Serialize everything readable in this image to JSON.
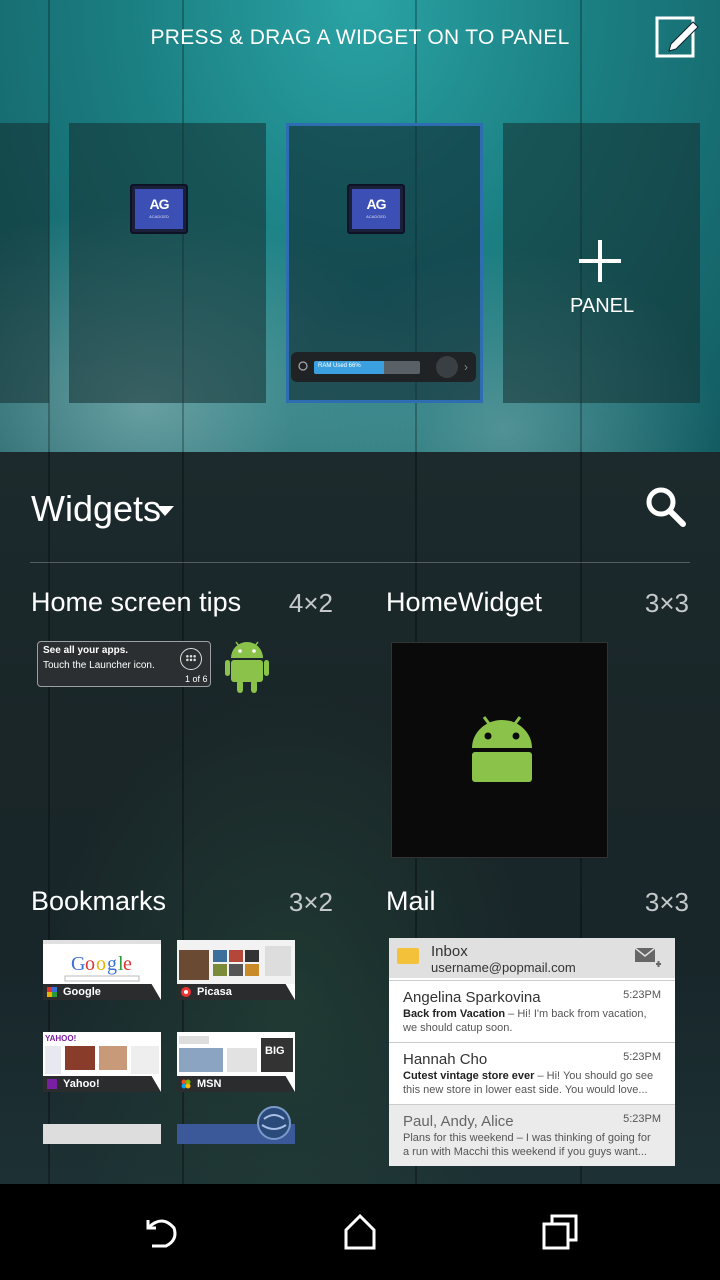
{
  "header": {
    "hint": "PRESS & DRAG A WIDGET ON TO PANEL"
  },
  "panels": {
    "ag_logo_text": "AG",
    "ag_logo_sub": "ACADGED",
    "ram_label": "RAM Used 66%",
    "ram_used_fraction": 0.66,
    "add_panel_label": "PANEL"
  },
  "drawer": {
    "title": "Widgets",
    "widgets": [
      {
        "name": "Home screen tips",
        "size": "4×2"
      },
      {
        "name": "HomeWidget",
        "size": "3×3"
      },
      {
        "name": "Bookmarks",
        "size": "3×2"
      },
      {
        "name": "Mail",
        "size": "3×3"
      }
    ]
  },
  "tips": {
    "line1": "See all your apps.",
    "line2": "Touch the Launcher icon.",
    "counter": "1 of 6"
  },
  "bookmarks": [
    {
      "label": "Google"
    },
    {
      "label": "Picasa"
    },
    {
      "label": "Yahoo!"
    },
    {
      "label": "MSN"
    }
  ],
  "mail": {
    "header_title": "Inbox",
    "account": "username@popmail.com",
    "messages": [
      {
        "from": "Angelina Sparkovina",
        "time": "5:23PM",
        "subject": "Back from Vacation",
        "preview1": " – Hi! I'm back from vacation,",
        "preview2": "we should catup soon."
      },
      {
        "from": "Hannah Cho",
        "time": "5:23PM",
        "subject": "Cutest vintage store ever",
        "preview1": " – Hi! You should go see",
        "preview2": "this new store in lower east side. You would love..."
      },
      {
        "from": "Paul, Andy, Alice",
        "time": "5:23PM",
        "subject": "Plans for this weekend",
        "preview1": " – I was thinking of going for",
        "preview2": "a run with Macchi this weekend if you guys want..."
      }
    ]
  },
  "colors": {
    "selected_border": "#2f6db3",
    "android_green": "#8bc34a",
    "ram_fill": "#3aa0e0"
  }
}
